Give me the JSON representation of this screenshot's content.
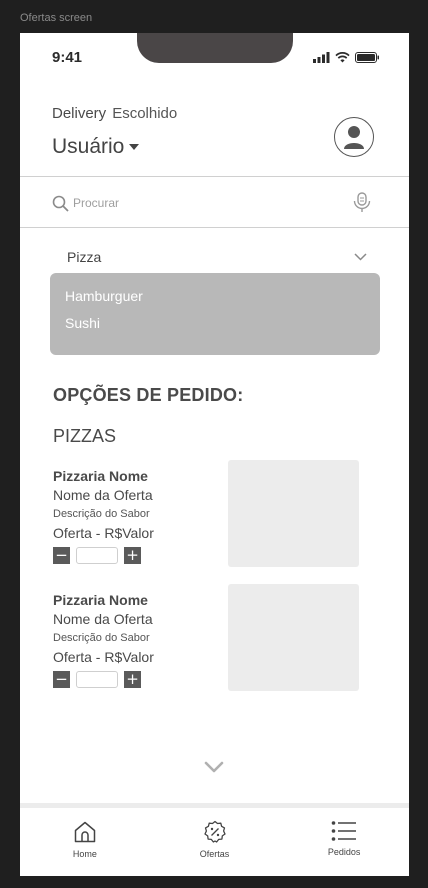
{
  "frame": {
    "label": "Ofertas screen"
  },
  "status_bar": {
    "time": "9:41",
    "icons": [
      "signal-icon",
      "wifi-icon",
      "battery-icon"
    ]
  },
  "header": {
    "delivery_label": "Delivery",
    "chosen_label": "Escolhido",
    "user_label": "Usuário",
    "user_icon": "caret-down-icon",
    "avatar_icon": "user-avatar-icon"
  },
  "search": {
    "placeholder": "Procurar",
    "icon": "search-icon",
    "mic_icon": "microphone-icon"
  },
  "category_select": {
    "selected": "Pizza",
    "options": [
      "Hamburguer",
      "Sushi"
    ]
  },
  "section_title": "OPÇÕES DE PEDIDO:",
  "category_title": "PIZZAS",
  "offers": [
    {
      "store": "Pizzaria Nome",
      "name": "Nome da Oferta",
      "flavor": "Descrição do Sabor",
      "price": "Oferta - R$Valor",
      "quantity": ""
    },
    {
      "store": "Pizzaria Nome",
      "name": "Nome da Oferta",
      "flavor": "Descrição do Sabor",
      "price": "Oferta - R$Valor",
      "quantity": ""
    }
  ],
  "quantity_controls": {
    "minus": "−",
    "plus": "+"
  },
  "bottom_nav": {
    "items": [
      {
        "label": "Home",
        "icon": "home-icon"
      },
      {
        "label": "Ofertas",
        "icon": "discount-badge-icon"
      },
      {
        "label": "Pedidos",
        "icon": "list-icon"
      }
    ]
  },
  "colors": {
    "background": "#1f1f1f",
    "screen": "#ffffff",
    "dropdown": "#b8b8b8",
    "placeholder_image": "#ececec",
    "text": "#4a4a4a"
  }
}
